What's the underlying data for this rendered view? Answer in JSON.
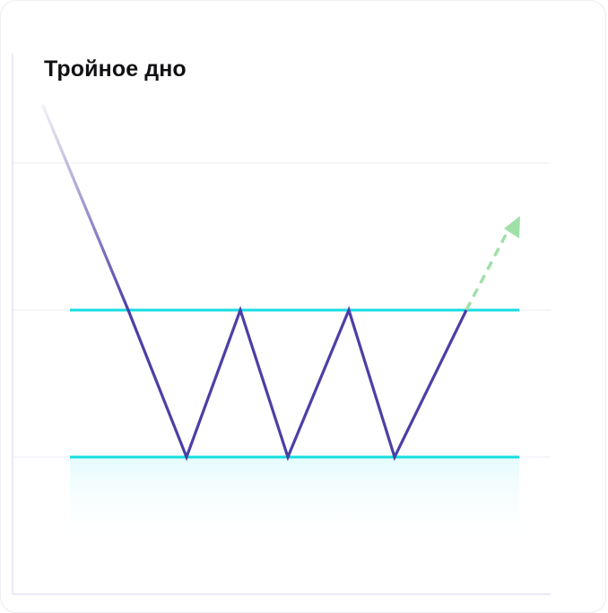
{
  "title": "Тройное дно",
  "colors": {
    "price_line": "#4b3fa6",
    "levels": "#17dde0",
    "breakout_arrow": "#9fe0a8",
    "grid": "#eeeef4",
    "axis": "#dcdcf0",
    "shade": "#e6fbfd"
  },
  "diagram": {
    "pattern": "triple-bottom",
    "bottoms_count": 3,
    "intermediate_peaks_count": 2,
    "breakout_direction": "up",
    "icons": [
      "breakout-arrow-icon"
    ]
  }
}
